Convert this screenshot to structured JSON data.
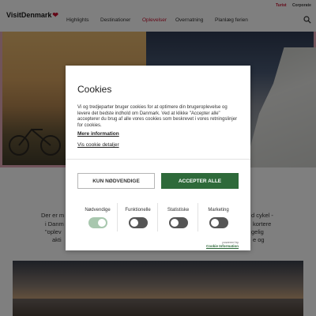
{
  "topbar": {
    "turist": "Turist",
    "corporate": "Corporate"
  },
  "header": {
    "logo": "VisitDenmark",
    "nav": [
      {
        "label": "Highlights",
        "active": false
      },
      {
        "label": "Destinationer",
        "active": false
      },
      {
        "label": "Oplevelser",
        "active": true
      },
      {
        "label": "Overnatning",
        "active": false
      },
      {
        "label": "Planlæg ferien",
        "active": false
      }
    ]
  },
  "body": {
    "line1_left": "Der er m",
    "line2_left": "i Danm",
    "line3_left": "\"oplev",
    "line4_left": "akti",
    "line1_right": "d cykel -",
    "line2_right": "kortere",
    "line3_right": "gelig",
    "line4_right": "e og"
  },
  "cookie": {
    "title": "Cookies",
    "description": "Vi og tredjeparter bruger cookies for at optimere din brugeroplevelse og levere det bedste indhold om Danmark. Ved at klikke \"Accepter alle\" accepterer du brug af alle vores cookies som beskrevet i vores retningslinjer for cookies.",
    "more_info": "Mere information",
    "details": "Vis cookie detaljer",
    "btn_necessary": "KUN NØDVENDIGE",
    "btn_accept": "ACCEPTER ALLE",
    "toggles": [
      {
        "label": "Nødvendige",
        "on": true,
        "disabled": true
      },
      {
        "label": "Funktionelle",
        "on": false
      },
      {
        "label": "Statistiske",
        "on": false
      },
      {
        "label": "Marketing",
        "on": false
      }
    ],
    "powered_by": "powered by",
    "cookie_information": "Cookie Information"
  },
  "colors": {
    "brand_red": "#c8102e",
    "accept_green": "#2e6a3a",
    "toggle_off": "#555555",
    "toggle_disabled": "#a8c7ae"
  }
}
